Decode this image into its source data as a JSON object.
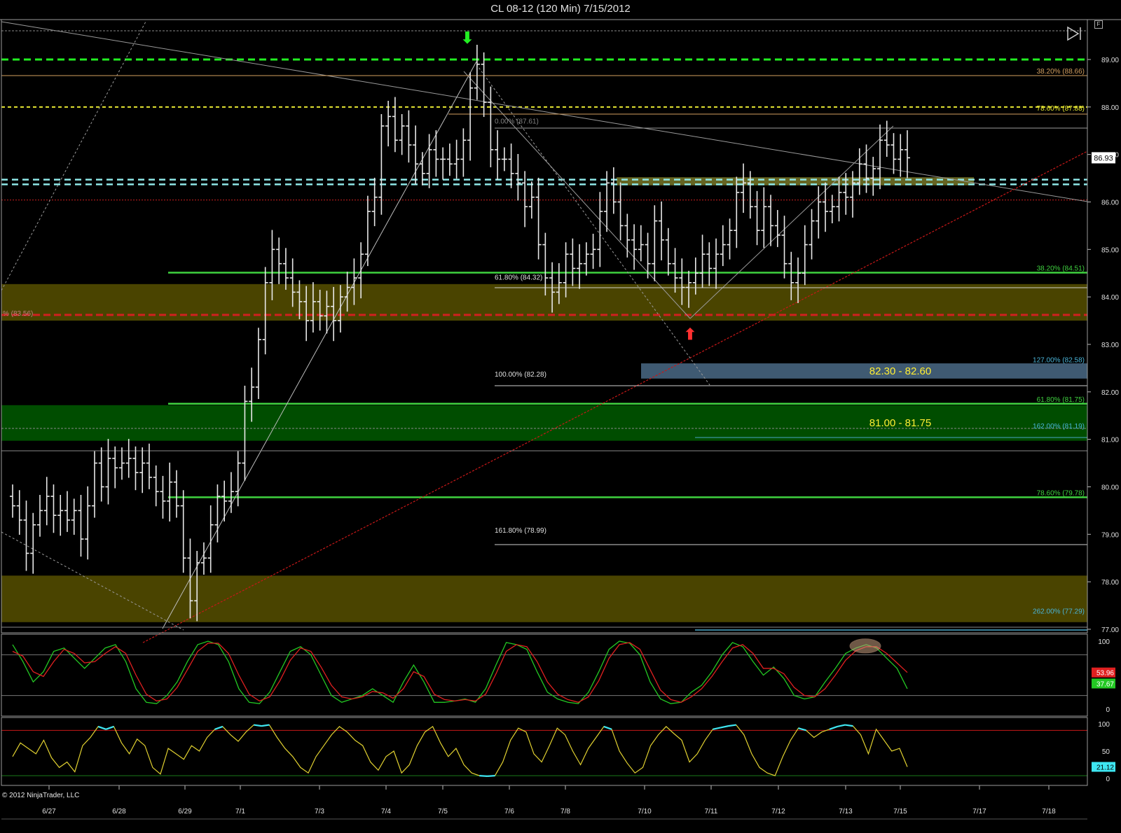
{
  "window": {
    "title": "CL 08-12 (120 Min)  7/15/2012",
    "copyright": "© 2012 NinjaTrader, LLC",
    "f_button": "F"
  },
  "colors": {
    "background": "#000000",
    "bar": "#e8e8e8",
    "green_level": "#3fd23f",
    "green_dashed": "#22ee22",
    "yellow_dashed": "#e6e632",
    "cyan_dashed": "#8fe8e8",
    "red_level": "#d02020",
    "zone_olive": "#4a4400",
    "zone_green": "#004d00",
    "zone_blue": "#4a6a86",
    "stoch_k": "#23c823",
    "stoch_d": "#e02020",
    "osc": "#e0d030",
    "osc_high": "#3ee6f2"
  },
  "chart_data": [
    {
      "type": "ohlc-bar",
      "panel": "price",
      "instrument": "CL 08-12",
      "interval": "120 Min",
      "ylim": [
        76.9,
        89.75
      ],
      "y_ticks": [
        "89.00",
        "88.00",
        "87.00",
        "86.00",
        "85.00",
        "84.00",
        "83.00",
        "82.00",
        "81.00",
        "80.00",
        "79.00",
        "78.00",
        "77.00"
      ],
      "x_ticks": [
        "6/27",
        "6/28",
        "6/29",
        "7/1",
        "7/3",
        "7/4",
        "7/5",
        "7/6",
        "7/8",
        "7/10",
        "7/11",
        "7/12",
        "7/13",
        "7/15",
        "7/17",
        "7/18"
      ],
      "last_price": "86.93",
      "series": [
        {
          "name": "CL 08-12",
          "close": [
            79.6,
            79.3,
            78.6,
            79.2,
            79.5,
            79.8,
            79.4,
            79.5,
            79.3,
            79.5,
            78.9,
            79.6,
            80.5,
            80.0,
            80.6,
            80.4,
            80.5,
            80.6,
            80.3,
            80.5,
            80.2,
            79.9,
            79.7,
            80.1,
            79.6,
            78.5,
            77.6,
            78.4,
            78.5,
            79.2,
            79.8,
            79.7,
            79.9,
            80.5,
            81.8,
            82.1,
            83.1,
            84.3,
            85.0,
            84.7,
            84.4,
            84.1,
            83.9,
            83.5,
            83.9,
            83.6,
            83.8,
            83.5,
            84.0,
            84.2,
            84.4,
            84.9,
            85.8,
            86.1,
            87.6,
            87.8,
            87.3,
            87.6,
            87.2,
            86.8,
            86.6,
            87.1,
            86.9,
            86.9,
            86.8,
            86.9,
            87.3,
            88.4,
            88.9,
            88.1,
            87.1,
            86.9,
            86.9,
            86.6,
            86.4,
            85.9,
            86.1,
            85.1,
            84.4,
            84.1,
            84.3,
            84.9,
            84.6,
            84.7,
            84.9,
            85.0,
            85.8,
            86.4,
            86.0,
            85.5,
            85.2,
            85.0,
            85.1,
            84.7,
            85.6,
            85.2,
            84.7,
            84.4,
            84.2,
            84.3,
            84.5,
            84.9,
            84.6,
            84.9,
            85.1,
            85.4,
            86.2,
            86.4,
            85.9,
            85.4,
            85.9,
            85.5,
            85.3,
            84.7,
            84.3,
            84.5,
            85.1,
            85.6,
            86.0,
            85.8,
            85.9,
            86.2,
            86.1,
            86.4,
            86.8,
            86.5,
            86.7,
            87.3,
            87.2,
            86.9,
            87.1,
            86.93
          ]
        }
      ],
      "annotations": [
        {
          "text": "38.20% (88.66)",
          "price": 88.66
        },
        {
          "text": "78.60% (87.88)",
          "price": 87.88
        },
        {
          "text": "0.00% (87.61)",
          "price": 87.61
        },
        {
          "text": "38.20% (84.51)",
          "price": 84.51
        },
        {
          "text": "61.80% (84.32)",
          "price": 84.32
        },
        {
          "text": "% (83.56)",
          "price": 83.56
        },
        {
          "text": "127.00% (82.58)",
          "price": 82.58
        },
        {
          "text": "100.00% (82.28)",
          "price": 82.28
        },
        {
          "text": "61.80% (81.75)",
          "price": 81.75
        },
        {
          "text": "162.00% (81.19)",
          "price": 81.19
        },
        {
          "text": "78.60% (79.78)",
          "price": 79.78
        },
        {
          "text": "161.80% (78.99)",
          "price": 78.99
        },
        {
          "text": "262.00% (77.29)",
          "price": 77.29
        }
      ],
      "zones": [
        {
          "label": "82.30 - 82.60",
          "low": 82.28,
          "high": 82.6
        },
        {
          "label": "81.00 - 81.75",
          "low": 80.97,
          "high": 81.72
        },
        {
          "label": "",
          "low": 83.5,
          "high": 84.27
        },
        {
          "label": "",
          "low": 77.15,
          "high": 78.13
        },
        {
          "label": "",
          "low": 86.35,
          "high": 86.52
        }
      ],
      "levels": [
        {
          "price": 89.0,
          "style": "green-dashed"
        },
        {
          "price": 88.0,
          "style": "yellow-dashed"
        },
        {
          "price": 86.47,
          "style": "cyan-dashed"
        },
        {
          "price": 86.37,
          "style": "cyan-dashed"
        },
        {
          "price": 86.04,
          "style": "red-dotted"
        },
        {
          "price": 84.51,
          "style": "green"
        },
        {
          "price": 83.62,
          "style": "red-dashed"
        },
        {
          "price": 81.75,
          "style": "green"
        },
        {
          "price": 79.78,
          "style": "green"
        }
      ],
      "markers": [
        {
          "symbol": "⬇",
          "color": "#22ee22",
          "price": 89.35
        },
        {
          "symbol": "⬆",
          "color": "#ff3030",
          "price": 83.1
        }
      ]
    },
    {
      "type": "line",
      "panel": "stochastics",
      "ylim": [
        0,
        100
      ],
      "y_ticks": [
        "100",
        "0"
      ],
      "readouts": [
        "53.96",
        "37.67"
      ],
      "series": [
        {
          "name": "",
          "color": "#23c823",
          "values": [
            95,
            70,
            40,
            55,
            85,
            90,
            75,
            60,
            75,
            90,
            95,
            70,
            30,
            10,
            8,
            20,
            40,
            70,
            95,
            100,
            95,
            70,
            30,
            10,
            8,
            25,
            55,
            85,
            92,
            80,
            50,
            20,
            10,
            15,
            20,
            30,
            20,
            10,
            40,
            65,
            40,
            10,
            10,
            12,
            15,
            10,
            30,
            65,
            98,
            95,
            88,
            55,
            25,
            15,
            10,
            8,
            25,
            55,
            88,
            100,
            97,
            80,
            40,
            15,
            8,
            10,
            25,
            35,
            55,
            80,
            98,
            92,
            70,
            50,
            62,
            45,
            20,
            15,
            18,
            40,
            60,
            82,
            90,
            95,
            90,
            75,
            60,
            30
          ]
        },
        {
          "name": "",
          "color": "#e02020",
          "values": [
            85,
            78,
            55,
            48,
            70,
            88,
            82,
            68,
            70,
            82,
            92,
            82,
            50,
            22,
            12,
            15,
            32,
            58,
            85,
            97,
            97,
            82,
            50,
            22,
            12,
            18,
            42,
            72,
            90,
            85,
            62,
            35,
            18,
            15,
            18,
            26,
            24,
            16,
            30,
            55,
            48,
            22,
            14,
            12,
            14,
            12,
            22,
            52,
            85,
            95,
            92,
            70,
            40,
            22,
            14,
            10,
            18,
            42,
            75,
            95,
            98,
            88,
            58,
            28,
            14,
            10,
            18,
            30,
            48,
            70,
            90,
            95,
            82,
            60,
            60,
            52,
            32,
            20,
            18,
            30,
            50,
            72,
            86,
            92,
            92,
            82,
            68,
            53.96
          ]
        }
      ]
    },
    {
      "type": "line",
      "panel": "oscillator",
      "ylim": [
        0,
        100
      ],
      "y_ticks": [
        "100",
        "50",
        "0"
      ],
      "readouts": [
        "21.12"
      ],
      "series": [
        {
          "name": "",
          "values": [
            40,
            65,
            55,
            45,
            70,
            38,
            20,
            30,
            12,
            60,
            75,
            95,
            90,
            95,
            65,
            45,
            72,
            60,
            20,
            8,
            55,
            45,
            35,
            60,
            50,
            75,
            90,
            95,
            80,
            68,
            85,
            98,
            96,
            98,
            75,
            55,
            40,
            20,
            10,
            40,
            60,
            80,
            95,
            85,
            70,
            60,
            30,
            15,
            40,
            50,
            10,
            25,
            60,
            85,
            95,
            65,
            40,
            55,
            25,
            10,
            5,
            4,
            5,
            30,
            70,
            92,
            85,
            45,
            30,
            60,
            92,
            80,
            50,
            25,
            55,
            75,
            95,
            90,
            50,
            28,
            10,
            20,
            60,
            80,
            95,
            82,
            70,
            30,
            45,
            70,
            90,
            93,
            96,
            98,
            80,
            45,
            20,
            10,
            5,
            40,
            70,
            92,
            88,
            75,
            85,
            90,
            95,
            98,
            96,
            80,
            45,
            90,
            70,
            50,
            55,
            21.12
          ]
        }
      ]
    }
  ]
}
